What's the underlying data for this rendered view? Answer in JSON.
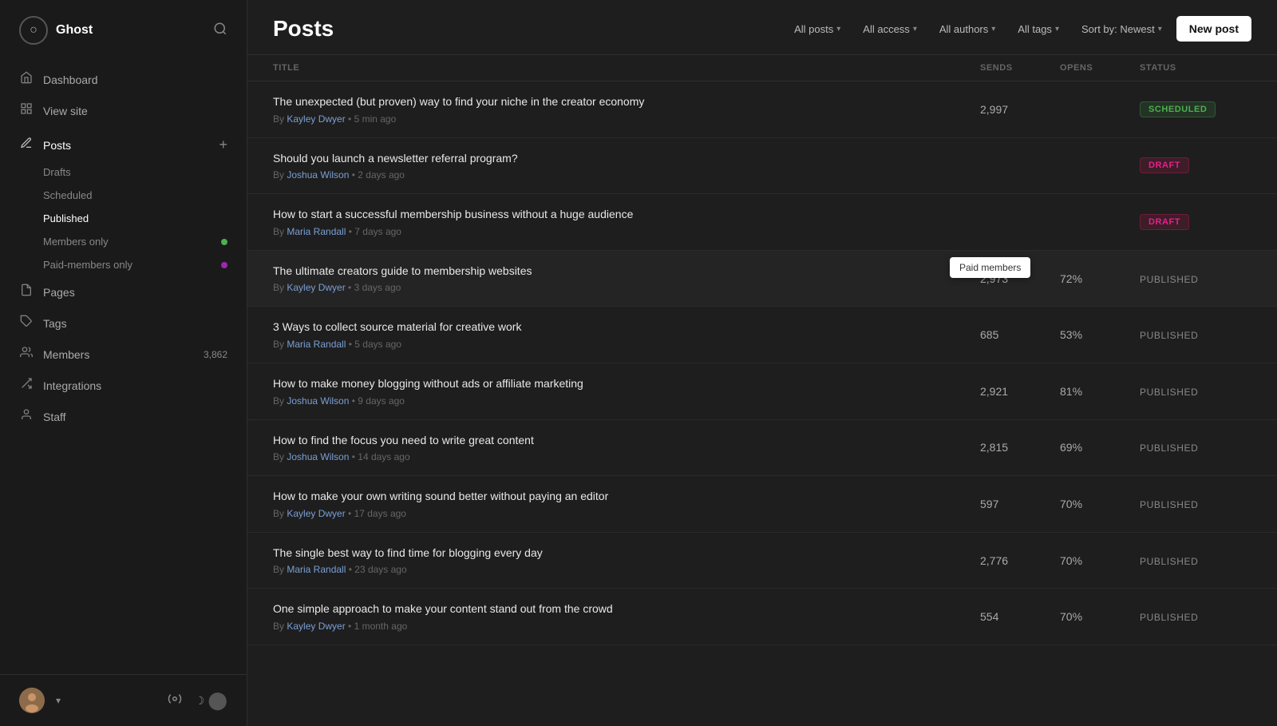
{
  "sidebar": {
    "brand": {
      "logo": "○",
      "name": "Ghost"
    },
    "nav_items": [
      {
        "id": "dashboard",
        "icon": "⌂",
        "label": "Dashboard"
      },
      {
        "id": "view-site",
        "icon": "⊡",
        "label": "View site"
      }
    ],
    "posts": {
      "label": "Posts",
      "add_icon": "+",
      "sub_items": [
        {
          "id": "drafts",
          "label": "Drafts"
        },
        {
          "id": "scheduled",
          "label": "Scheduled"
        },
        {
          "id": "published",
          "label": "Published"
        },
        {
          "id": "members-only",
          "label": "Members only",
          "dot": "green"
        },
        {
          "id": "paid-members-only",
          "label": "Paid-members only",
          "dot": "purple"
        }
      ]
    },
    "bottom_nav": [
      {
        "id": "pages",
        "icon": "⎘",
        "label": "Pages"
      },
      {
        "id": "tags",
        "icon": "⌖",
        "label": "Tags"
      },
      {
        "id": "members",
        "icon": "⊙",
        "label": "Members",
        "count": "3,862"
      },
      {
        "id": "integrations",
        "icon": "◈",
        "label": "Integrations"
      },
      {
        "id": "staff",
        "icon": "✦",
        "label": "Staff"
      }
    ],
    "footer": {
      "user_avatar": "👤",
      "chevron": "▾",
      "settings_icon": "⚙",
      "theme_moon": "☽",
      "theme_toggle": "●"
    }
  },
  "header": {
    "title": "Posts",
    "filters": [
      {
        "id": "all-posts",
        "label": "All posts"
      },
      {
        "id": "all-access",
        "label": "All access"
      },
      {
        "id": "all-authors",
        "label": "All authors"
      },
      {
        "id": "all-tags",
        "label": "All tags"
      },
      {
        "id": "sort",
        "label": "Sort by: Newest"
      }
    ],
    "new_post_label": "New post"
  },
  "table": {
    "columns": [
      {
        "id": "title",
        "label": "TITLE"
      },
      {
        "id": "sends",
        "label": "SENDS"
      },
      {
        "id": "opens",
        "label": "OPENS"
      },
      {
        "id": "status",
        "label": "STATUS"
      }
    ],
    "rows": [
      {
        "id": "row-1",
        "title": "The unexpected (but proven) way to find your niche in the creator economy",
        "author": "Kayley Dwyer",
        "time": "5 min ago",
        "sends": "2,997",
        "opens": "",
        "status": "SCHEDULED",
        "status_type": "scheduled",
        "tooltip": null
      },
      {
        "id": "row-2",
        "title": "Should you launch a newsletter referral program?",
        "author": "Joshua Wilson",
        "time": "2 days ago",
        "sends": "",
        "opens": "",
        "status": "DRAFT",
        "status_type": "draft",
        "tooltip": null
      },
      {
        "id": "row-3",
        "title": "How to start a successful membership business without a huge audience",
        "author": "Maria Randall",
        "time": "7 days ago",
        "sends": "",
        "opens": "",
        "status": "DRAFT",
        "status_type": "draft",
        "tooltip": null
      },
      {
        "id": "row-4",
        "title": "The ultimate creators guide to membership websites",
        "author": "Kayley Dwyer",
        "time": "3 days ago",
        "sends": "2,973",
        "opens": "72%",
        "status": "PUBLISHED",
        "status_type": "published",
        "tooltip": "Paid members",
        "highlighted": true
      },
      {
        "id": "row-5",
        "title": "3 Ways to collect source material for creative work",
        "author": "Maria Randall",
        "time": "5 days ago",
        "sends": "685",
        "opens": "53%",
        "status": "PUBLISHED",
        "status_type": "published",
        "tooltip": null
      },
      {
        "id": "row-6",
        "title": "How to make money blogging without ads or affiliate marketing",
        "author": "Joshua Wilson",
        "time": "9 days ago",
        "sends": "2,921",
        "opens": "81%",
        "status": "PUBLISHED",
        "status_type": "published",
        "tooltip": null
      },
      {
        "id": "row-7",
        "title": "How to find the focus you need to write great content",
        "author": "Joshua Wilson",
        "time": "14 days ago",
        "sends": "2,815",
        "opens": "69%",
        "status": "PUBLISHED",
        "status_type": "published",
        "tooltip": null
      },
      {
        "id": "row-8",
        "title": "How to make your own writing sound better without paying an editor",
        "author": "Kayley Dwyer",
        "time": "17 days ago",
        "sends": "597",
        "opens": "70%",
        "status": "PUBLISHED",
        "status_type": "published",
        "tooltip": null
      },
      {
        "id": "row-9",
        "title": "The single best way to find time for blogging every day",
        "author": "Maria Randall",
        "time": "23 days ago",
        "sends": "2,776",
        "opens": "70%",
        "status": "PUBLISHED",
        "status_type": "published",
        "tooltip": null
      },
      {
        "id": "row-10",
        "title": "One simple approach to make your content stand out from the crowd",
        "author": "Kayley Dwyer",
        "time": "1 month ago",
        "sends": "554",
        "opens": "70%",
        "status": "PUBLISHED",
        "status_type": "published",
        "tooltip": null
      }
    ]
  }
}
